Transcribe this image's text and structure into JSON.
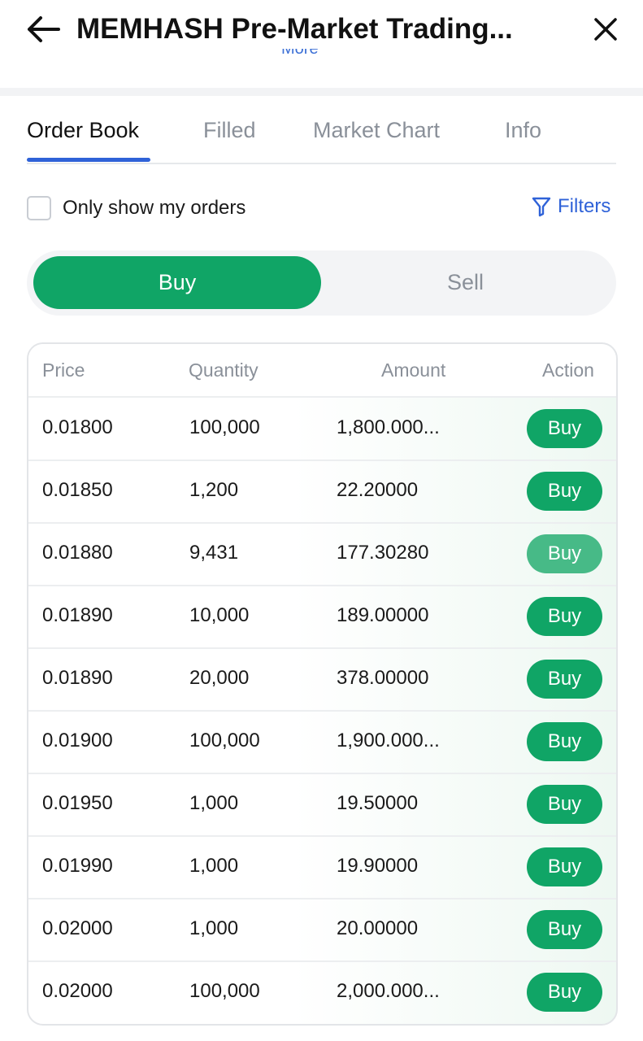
{
  "header": {
    "title": "MEMHASH Pre-Market Trading...",
    "more_link": "More"
  },
  "tabs": [
    {
      "label": "Order Book",
      "active": true
    },
    {
      "label": "Filled",
      "active": false
    },
    {
      "label": "Market Chart",
      "active": false
    },
    {
      "label": "Info",
      "active": false
    }
  ],
  "filter_row": {
    "only_my_orders_label": "Only show my orders",
    "only_my_orders_checked": false,
    "filters_label": "Filters"
  },
  "side_toggle": {
    "buy_label": "Buy",
    "sell_label": "Sell",
    "selected": "Buy"
  },
  "order_table": {
    "columns": [
      "Price",
      "Quantity",
      "Amount",
      "Action"
    ],
    "rows": [
      {
        "price": "0.01800",
        "quantity": "100,000",
        "amount": "1,800.000...",
        "action": "Buy"
      },
      {
        "price": "0.01850",
        "quantity": "1,200",
        "amount": "22.20000",
        "action": "Buy"
      },
      {
        "price": "0.01880",
        "quantity": "9,431",
        "amount": "177.30280",
        "action": "Buy"
      },
      {
        "price": "0.01890",
        "quantity": "10,000",
        "amount": "189.00000",
        "action": "Buy"
      },
      {
        "price": "0.01890",
        "quantity": "20,000",
        "amount": "378.00000",
        "action": "Buy"
      },
      {
        "price": "0.01900",
        "quantity": "100,000",
        "amount": "1,900.000...",
        "action": "Buy"
      },
      {
        "price": "0.01950",
        "quantity": "1,000",
        "amount": "19.50000",
        "action": "Buy"
      },
      {
        "price": "0.01990",
        "quantity": "1,000",
        "amount": "19.90000",
        "action": "Buy"
      },
      {
        "price": "0.02000",
        "quantity": "1,000",
        "amount": "20.00000",
        "action": "Buy"
      },
      {
        "price": "0.02000",
        "quantity": "100,000",
        "amount": "2,000.000...",
        "action": "Buy"
      }
    ]
  },
  "colors": {
    "accent_green": "#10a566",
    "accent_blue": "#2f62d8",
    "muted_text": "#8a9099"
  },
  "icons": [
    "back-arrow-icon",
    "close-icon",
    "filter-icon",
    "checkbox-icon"
  ]
}
